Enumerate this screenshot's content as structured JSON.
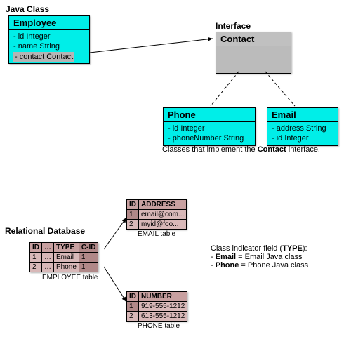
{
  "labels": {
    "javaClass": "Java Class",
    "interface": "Interface",
    "implementsNote_a": "Classes that implement the ",
    "implementsNote_b": "Contact",
    "implementsNote_c": " interface.",
    "relationalDb": "Relational Database",
    "indicatorTitle_a": "Class indicator field (",
    "indicatorTitle_b": "TYPE",
    "indicatorTitle_c": "):",
    "indicator1_a": "- ",
    "indicator1_b": "Email",
    "indicator1_c": " = Email Java class",
    "indicator2_a": "- ",
    "indicator2_b": "Phone",
    "indicator2_c": " = Phone Java class"
  },
  "classes": {
    "employee": {
      "name": "Employee",
      "attrs": [
        "- id Integer",
        "- name String",
        "- contact Contact"
      ]
    },
    "contact": {
      "name": "Contact"
    },
    "phone": {
      "name": "Phone",
      "attrs": [
        "- id Integer",
        "- phoneNumber String"
      ]
    },
    "email": {
      "name": "Email",
      "attrs": [
        "- address String",
        "- id Integer"
      ]
    }
  },
  "tables": {
    "employee": {
      "caption": "EMPLOYEE table",
      "cols": [
        "ID",
        "…",
        "TYPE",
        "C-ID"
      ],
      "rows": [
        [
          "1",
          "…",
          "Email",
          "1"
        ],
        [
          "2",
          "…",
          "Phone",
          "1"
        ]
      ]
    },
    "email": {
      "caption": "EMAIL table",
      "cols": [
        "ID",
        "ADDRESS"
      ],
      "rows": [
        [
          "1",
          "email@com..."
        ],
        [
          "2",
          "myid@foo..."
        ]
      ]
    },
    "phone": {
      "caption": "PHONE table",
      "cols": [
        "ID",
        "NUMBER"
      ],
      "rows": [
        [
          "1",
          "919-555-1212"
        ],
        [
          "2",
          "613-555-1212"
        ]
      ]
    }
  }
}
